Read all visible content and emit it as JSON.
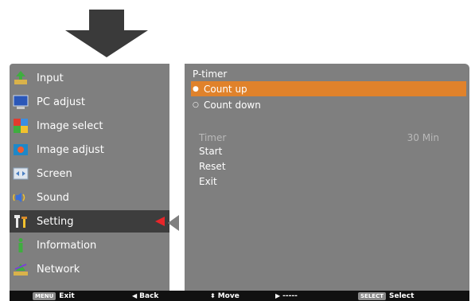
{
  "sidebar": {
    "items": [
      {
        "label": "Input",
        "icon": "input-icon"
      },
      {
        "label": "PC adjust",
        "icon": "pc-adjust-icon"
      },
      {
        "label": "Image select",
        "icon": "image-select-icon"
      },
      {
        "label": "Image adjust",
        "icon": "image-adjust-icon"
      },
      {
        "label": "Screen",
        "icon": "screen-icon"
      },
      {
        "label": "Sound",
        "icon": "sound-icon"
      },
      {
        "label": "Setting",
        "icon": "setting-icon"
      },
      {
        "label": "Information",
        "icon": "information-icon"
      },
      {
        "label": "Network",
        "icon": "network-icon"
      }
    ],
    "active": "Setting"
  },
  "panel": {
    "title": "P-timer",
    "options": [
      {
        "label": "Count up"
      },
      {
        "label": "Count down"
      }
    ],
    "selected_option": "Count up",
    "timer": {
      "label": "Timer",
      "value": "30 Min"
    },
    "actions": [
      {
        "label": "Start"
      },
      {
        "label": "Reset"
      },
      {
        "label": "Exit"
      }
    ]
  },
  "footer": {
    "exit_key": "MENU",
    "exit_label": "Exit",
    "back_label": "Back",
    "move_label": "Move",
    "next_label": "-----",
    "select_key": "SELECT",
    "select_label": "Select"
  },
  "colors": {
    "panel_bg": "#7f7f7f",
    "active_row": "#3d3d3d",
    "highlight": "#e0822b",
    "marker": "#e8262a",
    "footer_bg": "#111111"
  }
}
